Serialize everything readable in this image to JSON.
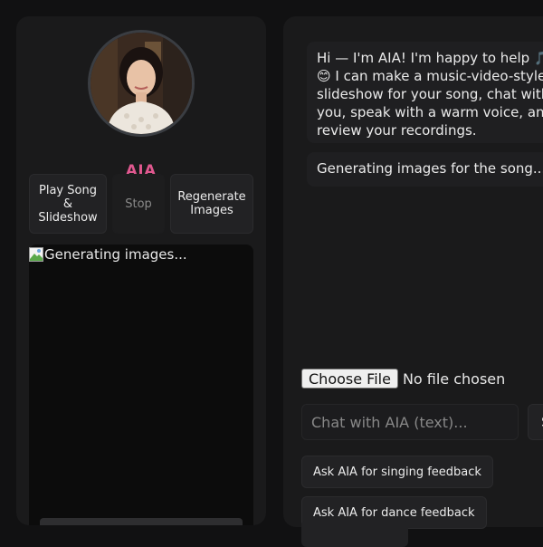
{
  "profile": {
    "name": "AIA"
  },
  "controls": {
    "play_label": "Play Song\n&\nSlideshow",
    "stop_label": "Stop",
    "regenerate_label": "Regenerate\nImages"
  },
  "slideshow": {
    "alt_text": "Generating images..."
  },
  "chat": {
    "messages": [
      "Hi — I'm AIA! I'm happy to help 🎵😊 I can make a music-video-style slideshow for your song, chat with you, speak with a warm voice, and review your recordings.",
      "Generating images for the song..."
    ],
    "file_button": "Choose File",
    "file_status": "No file chosen",
    "input_placeholder": "Chat with AIA (text)...",
    "send_label": "Send",
    "singing_feedback": "Ask AIA for singing feedback",
    "dance_feedback": "Ask AIA for dance feedback"
  },
  "colors": {
    "accent": "#e0588f",
    "background": "#111112",
    "panel": "#1a1a1b"
  }
}
